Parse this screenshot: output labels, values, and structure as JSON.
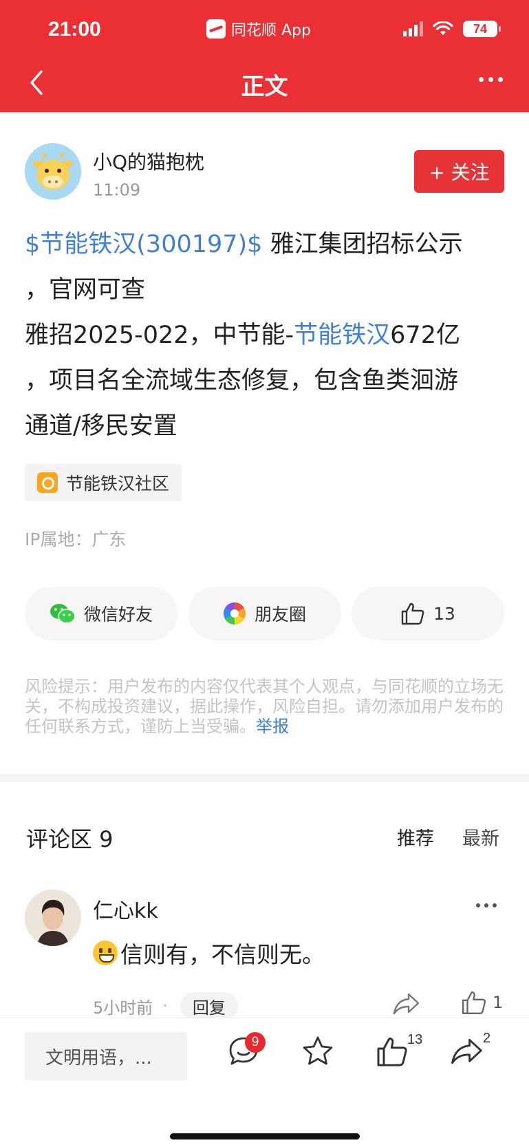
{
  "status_bar": {
    "time": "21:00",
    "app_name": "同花顺 App",
    "battery": "74"
  },
  "nav": {
    "title": "正文"
  },
  "author": {
    "name": "小Q的猫抱枕",
    "time": "11:09",
    "follow_label": "+ 关注"
  },
  "post": {
    "stock_tag": "$节能铁汉(300197)$",
    "text_1": " 雅江集团招标公示",
    "text_2": "，官网可查",
    "text_3": "雅招2025-022，中节能-",
    "stock_inline": "节能铁汉",
    "text_4": "672亿",
    "text_5": "，项目名全流域生态修复，包含鱼类洄游",
    "text_6": "通道/移民安置"
  },
  "community_tag": "节能铁汉社区",
  "ip_location": "IP属地：广东",
  "share": {
    "wechat": "微信好友",
    "moments": "朋友圈",
    "likes": "13"
  },
  "risk": {
    "text": "风险提示：用户发布的内容仅代表其个人观点，与同花顺的立场无关，不构成投资建议，据此操作，风险自担。请勿添加用户发布的任何联系方式，谨防上当受骗。",
    "report": "举报"
  },
  "comments": {
    "title": "评论区 9",
    "sort_recommend": "推荐",
    "sort_newest": "最新",
    "items": [
      {
        "user": "仁心kk",
        "text": "信则有，不信则无。",
        "time": "5小时前",
        "reply_label": "回复",
        "likes": "1"
      }
    ]
  },
  "bottom_bar": {
    "input_placeholder": "文明用语，...",
    "comment_count": "9",
    "like_count": "13",
    "share_count": "2"
  },
  "colors": {
    "brand_red": "#ea2f35",
    "link_blue": "#3f7fd4"
  }
}
